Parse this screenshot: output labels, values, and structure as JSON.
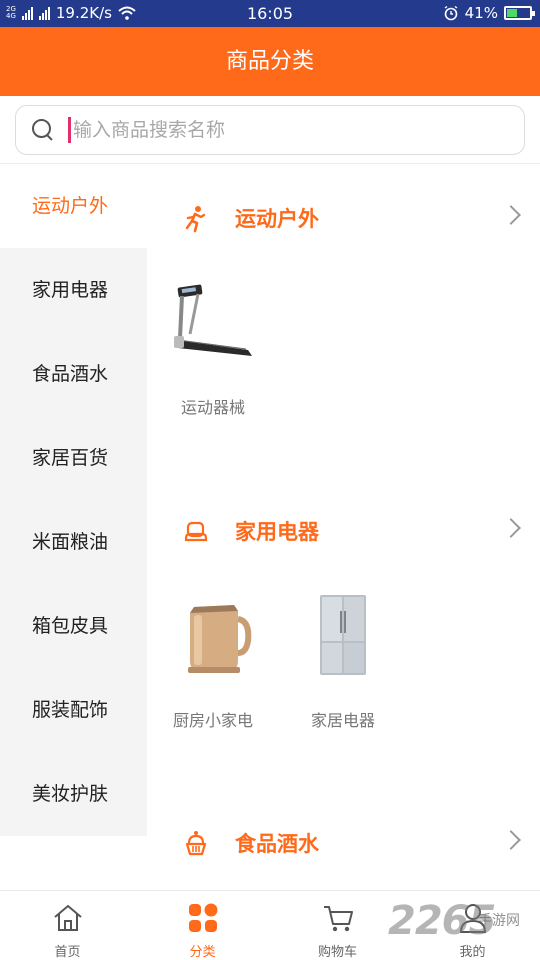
{
  "status_bar": {
    "network_top": "2G",
    "network_bottom": "4G",
    "speed": "19.2K/s",
    "time": "16:05",
    "battery": "41%",
    "battery_level": 0.41
  },
  "header": {
    "title": "商品分类"
  },
  "search": {
    "placeholder": "输入商品搜索名称",
    "value": ""
  },
  "sidebar": {
    "items": [
      {
        "label": "运动户外",
        "active": true
      },
      {
        "label": "家用电器",
        "active": false
      },
      {
        "label": "食品酒水",
        "active": false
      },
      {
        "label": "家居百货",
        "active": false
      },
      {
        "label": "米面粮油",
        "active": false
      },
      {
        "label": "箱包皮具",
        "active": false
      },
      {
        "label": "服装配饰",
        "active": false
      },
      {
        "label": "美妆护肤",
        "active": false
      }
    ]
  },
  "sections": [
    {
      "title": "运动户外",
      "icon": "running-icon",
      "products": [
        {
          "label": "运动器械",
          "icon": "treadmill-image"
        }
      ]
    },
    {
      "title": "家用电器",
      "icon": "appliance-icon",
      "products": [
        {
          "label": "厨房小家电",
          "icon": "kettle-image"
        },
        {
          "label": "家居电器",
          "icon": "fridge-image"
        }
      ]
    },
    {
      "title": "食品酒水",
      "icon": "cake-icon",
      "products": []
    }
  ],
  "bottom_nav": {
    "tabs": [
      {
        "label": "首页",
        "icon": "home-icon",
        "active": false
      },
      {
        "label": "分类",
        "icon": "category-icon",
        "active": true
      },
      {
        "label": "购物车",
        "icon": "cart-icon",
        "active": false
      },
      {
        "label": "我的",
        "icon": "user-icon",
        "active": false
      }
    ]
  },
  "watermark": {
    "text": "2265",
    "sub": "手游网"
  },
  "colors": {
    "accent": "#ff6a1a",
    "status_bar": "#243a8c",
    "sidebar_bg": "#f4f4f4"
  }
}
